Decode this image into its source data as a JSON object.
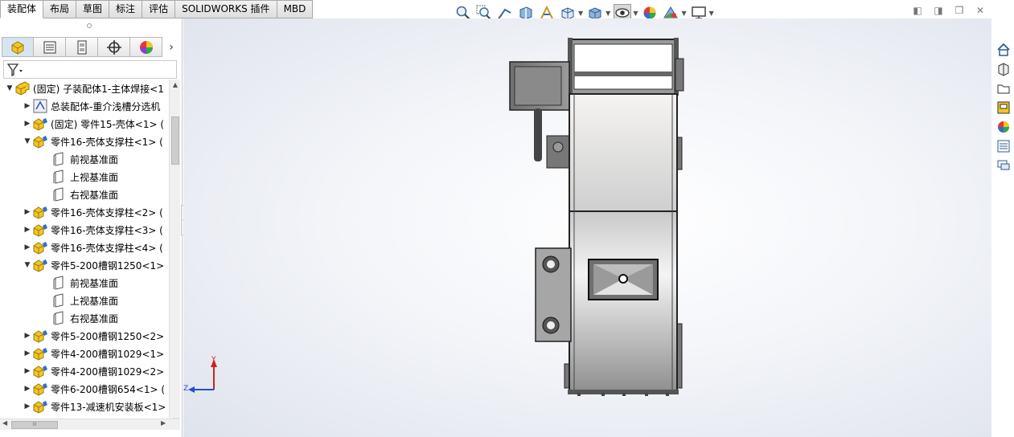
{
  "tabs": [
    "装配体",
    "布局",
    "草图",
    "标注",
    "评估",
    "SOLIDWORKS 插件",
    "MBD"
  ],
  "active_tab": "装配体",
  "hud_icons": [
    "zoom-to-fit-icon",
    "zoom-to-area-icon",
    "previous-view-icon",
    "section-view-icon",
    "dynamic-annotation-icon",
    "view-orientation-icon",
    "display-style-icon",
    "hide-show-items-icon",
    "edit-appearance-icon",
    "apply-scene-icon",
    "view-settings-icon"
  ],
  "panel_tabs": [
    "featuremanager-icon",
    "propertymanager-icon",
    "configurationmanager-icon",
    "dimxpert-icon",
    "displaymanager-icon"
  ],
  "tree": [
    {
      "level": 0,
      "expander": "▼",
      "icon": "assembly-icon",
      "label": "(固定) 子装配体1-主体焊接<1"
    },
    {
      "level": 1,
      "expander": "▶",
      "icon": "assembly-link-icon",
      "label": "总装配体-重介浅槽分选机"
    },
    {
      "level": 1,
      "expander": "▶",
      "icon": "part-icon",
      "label": "(固定) 零件15-壳体<1> ("
    },
    {
      "level": 1,
      "expander": "▼",
      "icon": "part-icon",
      "label": "零件16-壳体支撑柱<1> ("
    },
    {
      "level": 2,
      "expander": "",
      "icon": "plane-icon",
      "label": "前视基准面"
    },
    {
      "level": 2,
      "expander": "",
      "icon": "plane-icon",
      "label": "上视基准面"
    },
    {
      "level": 2,
      "expander": "",
      "icon": "plane-icon",
      "label": "右视基准面"
    },
    {
      "level": 1,
      "expander": "▶",
      "icon": "part-icon",
      "label": "零件16-壳体支撑柱<2> ("
    },
    {
      "level": 1,
      "expander": "▶",
      "icon": "part-icon",
      "label": "零件16-壳体支撑柱<3> ("
    },
    {
      "level": 1,
      "expander": "▶",
      "icon": "part-icon",
      "label": "零件16-壳体支撑柱<4> ("
    },
    {
      "level": 1,
      "expander": "▼",
      "icon": "part-icon",
      "label": "零件5-200槽钢1250<1>"
    },
    {
      "level": 2,
      "expander": "",
      "icon": "plane-icon",
      "label": "前视基准面"
    },
    {
      "level": 2,
      "expander": "",
      "icon": "plane-icon",
      "label": "上视基准面"
    },
    {
      "level": 2,
      "expander": "",
      "icon": "plane-icon",
      "label": "右视基准面"
    },
    {
      "level": 1,
      "expander": "▶",
      "icon": "part-icon",
      "label": "零件5-200槽钢1250<2>"
    },
    {
      "level": 1,
      "expander": "▶",
      "icon": "part-icon",
      "label": "零件4-200槽钢1029<1>"
    },
    {
      "level": 1,
      "expander": "▶",
      "icon": "part-icon",
      "label": "零件4-200槽钢1029<2>"
    },
    {
      "level": 1,
      "expander": "▶",
      "icon": "part-icon",
      "label": "零件6-200槽钢654<1> ("
    },
    {
      "level": 1,
      "expander": "▶",
      "icon": "part-icon",
      "label": "零件13-减速机安装板<1>"
    }
  ],
  "hscroll_thumb": "III",
  "triad": {
    "y_label": "Y",
    "z_label": "Z"
  },
  "task_pane": [
    "home-icon",
    "design-library-icon",
    "file-explorer-icon",
    "view-palette-icon",
    "appearances-icon",
    "custom-properties-icon",
    "forum-icon"
  ],
  "colors": {
    "accent": "#3a6ea5",
    "model_grey": "#8a8a8a",
    "selection_blue": "#d7e4f2"
  }
}
